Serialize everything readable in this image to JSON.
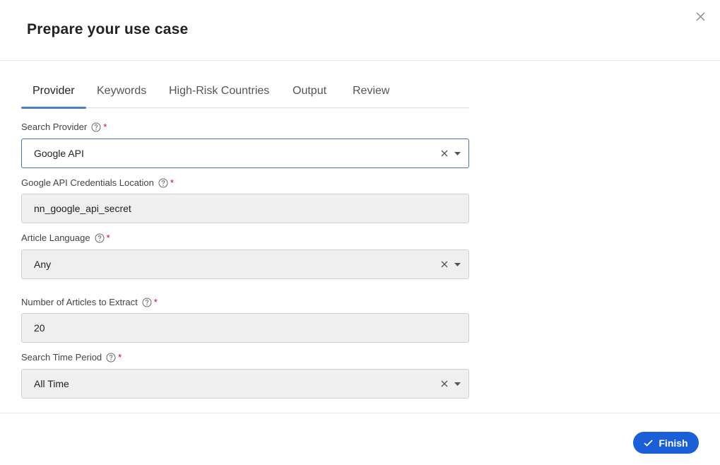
{
  "dialog": {
    "title": "Prepare your use case"
  },
  "tabs": [
    {
      "label": "Provider",
      "active": true
    },
    {
      "label": "Keywords",
      "active": false
    },
    {
      "label": "High-Risk Countries",
      "active": false
    },
    {
      "label": "Output",
      "active": false
    },
    {
      "label": "Review",
      "active": false
    }
  ],
  "form": {
    "search_provider": {
      "label": "Search Provider",
      "value": "Google API",
      "required_mark": "*"
    },
    "credentials_location": {
      "label": "Google API Credentials Location",
      "value": "nn_google_api_secret",
      "required_mark": "*"
    },
    "article_language": {
      "label": "Article Language",
      "value": "Any",
      "required_mark": "*"
    },
    "num_articles": {
      "label": "Number of Articles to Extract",
      "value": "20",
      "required_mark": "*"
    },
    "time_period": {
      "label": "Search Time Period",
      "value": "All Time",
      "required_mark": "*"
    }
  },
  "footer": {
    "finish_label": "Finish"
  },
  "icons": {
    "close": "close-icon",
    "help": "question-circle-icon",
    "clear": "x-icon",
    "caret": "caret-down-icon",
    "check": "check-icon"
  },
  "colors": {
    "accent": "#1a5fd8",
    "tab_indicator": "#4d7fc9",
    "required": "#d0021b",
    "focus_border": "#4a6fb0"
  }
}
